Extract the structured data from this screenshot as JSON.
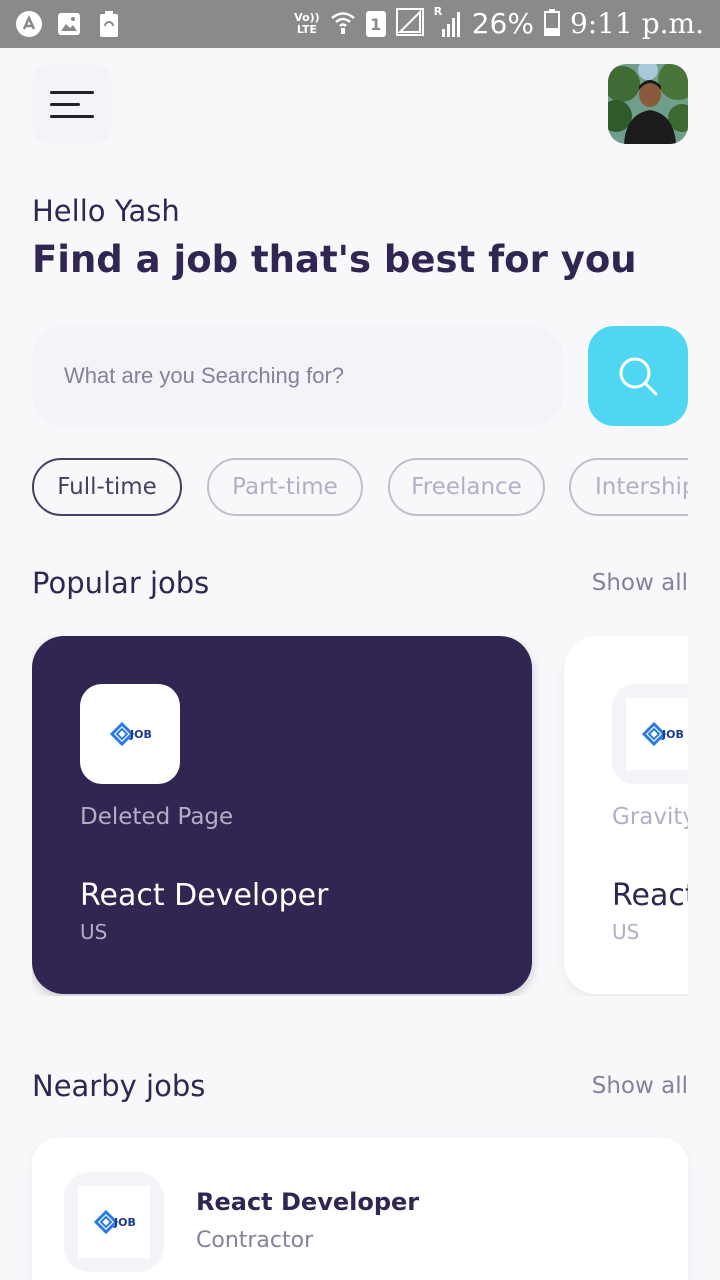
{
  "status_bar": {
    "volte": "Vo))",
    "lte": "LTE",
    "sim": "1",
    "net_type": "R",
    "battery": "26%",
    "time": "9:11 p.m."
  },
  "header": {
    "greeting": "Hello Yash",
    "headline": "Find a job that's best for you"
  },
  "search": {
    "placeholder": "What are you Searching for?"
  },
  "job_types": [
    {
      "label": "Full-time",
      "active": true
    },
    {
      "label": "Part-time",
      "active": false
    },
    {
      "label": "Freelance",
      "active": false
    },
    {
      "label": "Intership",
      "active": false
    }
  ],
  "popular": {
    "title": "Popular jobs",
    "show_all": "Show all",
    "cards": [
      {
        "company": "Deleted Page",
        "role": "React Developer",
        "country": "US"
      },
      {
        "company": "Gravity",
        "role": "React Developer",
        "country": "US"
      }
    ]
  },
  "nearby": {
    "title": "Nearby jobs",
    "show_all": "Show all",
    "cards": [
      {
        "role": "React Developer",
        "type": "Contractor"
      }
    ]
  },
  "logo_text": "JOB",
  "colors": {
    "primary": "#312651",
    "accent": "#4fd6f2",
    "gray": "#83829a",
    "light": "#f3f4f8"
  }
}
